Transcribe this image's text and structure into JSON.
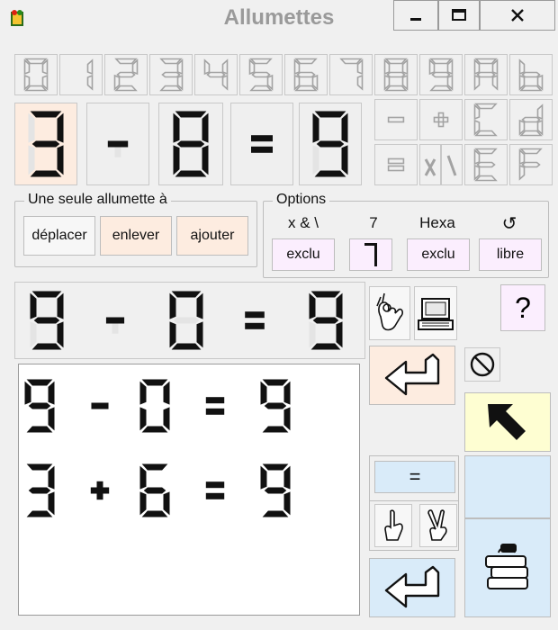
{
  "window": {
    "title": "Allumettes",
    "minimize_glyph": "‒",
    "maximize_glyph": "□",
    "close_glyph": "✕"
  },
  "keypad": {
    "digits": [
      "0",
      "1",
      "2",
      "3",
      "4",
      "5",
      "6",
      "7",
      "8",
      "9",
      "A",
      "b"
    ],
    "operators": [
      "−",
      "+",
      "C",
      "d",
      "=",
      "x",
      "\\",
      "E",
      "F"
    ]
  },
  "puzzle": {
    "chars": [
      "3",
      "-",
      "8",
      "=",
      "9"
    ]
  },
  "group_one_match": {
    "legend": "Une seule allumette à",
    "buttons": [
      "déplacer",
      "enlever",
      "ajouter"
    ]
  },
  "options": {
    "legend": "Options",
    "labels": [
      "x & \\",
      "7",
      "Hexa",
      "↺"
    ],
    "buttons": [
      "exclu",
      "7-seg",
      "exclu",
      "libre"
    ]
  },
  "current": {
    "chars": [
      "9",
      "-",
      "0",
      "=",
      "9"
    ]
  },
  "solutions": [
    [
      "9",
      "-",
      "0",
      "=",
      "9"
    ],
    [
      "3",
      "+",
      "6",
      "=",
      "9"
    ]
  ],
  "side": {
    "help_glyph": "?",
    "equals_label": "=",
    "icons": [
      "ok-hand-icon",
      "computer-icon",
      "undo-arrow-icon",
      "forbidden-icon",
      "up-left-arrow-icon",
      "one-finger-icon",
      "two-finger-icon",
      "books-icon",
      "undo-arrow-icon-2"
    ]
  },
  "colors": {
    "peach": "#fdece0",
    "lilac": "#fbeefe",
    "lightblue": "#d9ebf9",
    "lightyellow": "#fefed2"
  }
}
